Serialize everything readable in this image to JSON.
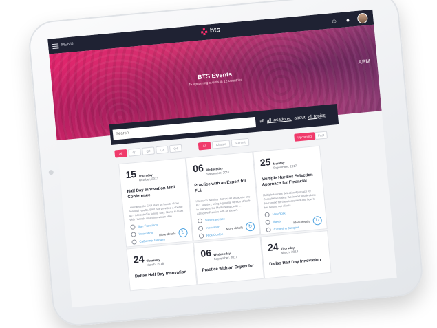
{
  "nav": {
    "menu_label": "MENU",
    "brand": "bts"
  },
  "hero": {
    "title": "BTS Events",
    "subtitle": "45 upcoming events in 12 countries",
    "sign_text": "APM"
  },
  "search": {
    "placeholder": "Search",
    "filter_all": "all",
    "filter_locations": "all locations,",
    "filter_about": "about",
    "filter_topics": "all topics"
  },
  "filters": {
    "group_one": [
      "All",
      "Q1",
      "Q2",
      "Q3",
      "Q4"
    ],
    "group_two": [
      "All",
      "Classic",
      "Summit"
    ],
    "group_three": [
      "Upcoming",
      "Past"
    ]
  },
  "cards": [
    {
      "day": "15",
      "weekday": "Thursday",
      "month_year": "October, 2017",
      "title": "Half Day Innovation Mini Conference",
      "description": "Leverages the SAP story on how to show financial results. SAP has provided a shorter up - interested in joining Stay. Name to learn with Hannah on an innovation plan.",
      "location": "San Francisco",
      "type": "Innovation",
      "contact": "Catherine Jacques",
      "more": "More details"
    },
    {
      "day": "06",
      "weekday": "Wednesday",
      "month_year": "September, 2017",
      "title": "Practice with an Expert for FLL",
      "description": "Hands-on Webinar that would showcase any FLL solution, using a general version of built-in overview, the Methodology, with ... Attractive Practice with an Expert.",
      "location": "San Francisco",
      "type": "Innovation",
      "contact": "Rick Conlon",
      "more": "More details"
    },
    {
      "day": "25",
      "weekday": "Monday",
      "month_year": "September, 2017",
      "title": "Multiple Hurdles Selection Approach for Financial",
      "description": "Multiple Hurdles Selection Approach for Consultative Sales. We intend to talk about the context for the assessment and how it has helped our clients.",
      "location": "New York",
      "type": "Sales",
      "contact": "Catherine Jacques",
      "more": "More details"
    },
    {
      "day": "24",
      "weekday": "Thursday",
      "month_year": "March, 2018",
      "title": "Dallas Half Day Innovation"
    },
    {
      "day": "06",
      "weekday": "Wednesday",
      "month_year": "September, 2017",
      "title": "Practice with an Expert for"
    },
    {
      "day": "24",
      "weekday": "Thursday",
      "month_year": "March, 2018",
      "title": "Dallas Half Day Innovation"
    }
  ]
}
